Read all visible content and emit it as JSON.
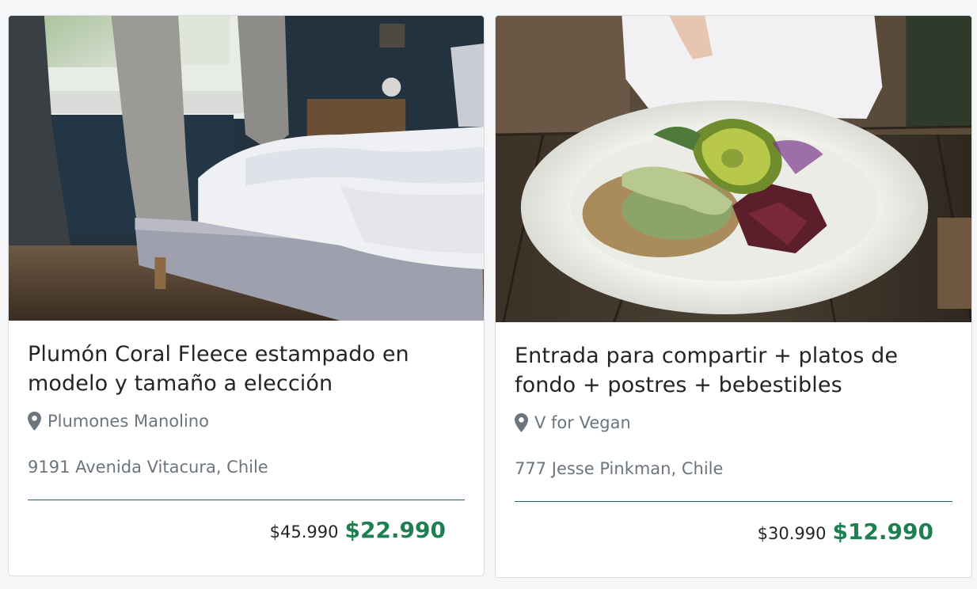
{
  "cards": [
    {
      "image": "bedroom-bed-photo",
      "title": "Plumón Coral Fleece estampado en modelo y tamaño a elección",
      "store": "Plumones Manolino",
      "store_icon": "map-pin-icon",
      "address": "9191 Avenida Vitacura, Chile",
      "old_price": "$45.990",
      "new_price": "$22.990"
    },
    {
      "image": "vegan-bowl-photo",
      "title": "Entrada para compartir + platos de fondo + postres + bebestibles",
      "store": "V for Vegan",
      "store_icon": "map-pin-icon",
      "address": "777 Jesse Pinkman, Chile",
      "old_price": "$30.990",
      "new_price": "$12.990"
    }
  ],
  "colors": {
    "accent_green": "#1e8050",
    "divider_green": "#1e6f49",
    "muted_text": "#6c757d",
    "title_text": "#212529"
  }
}
